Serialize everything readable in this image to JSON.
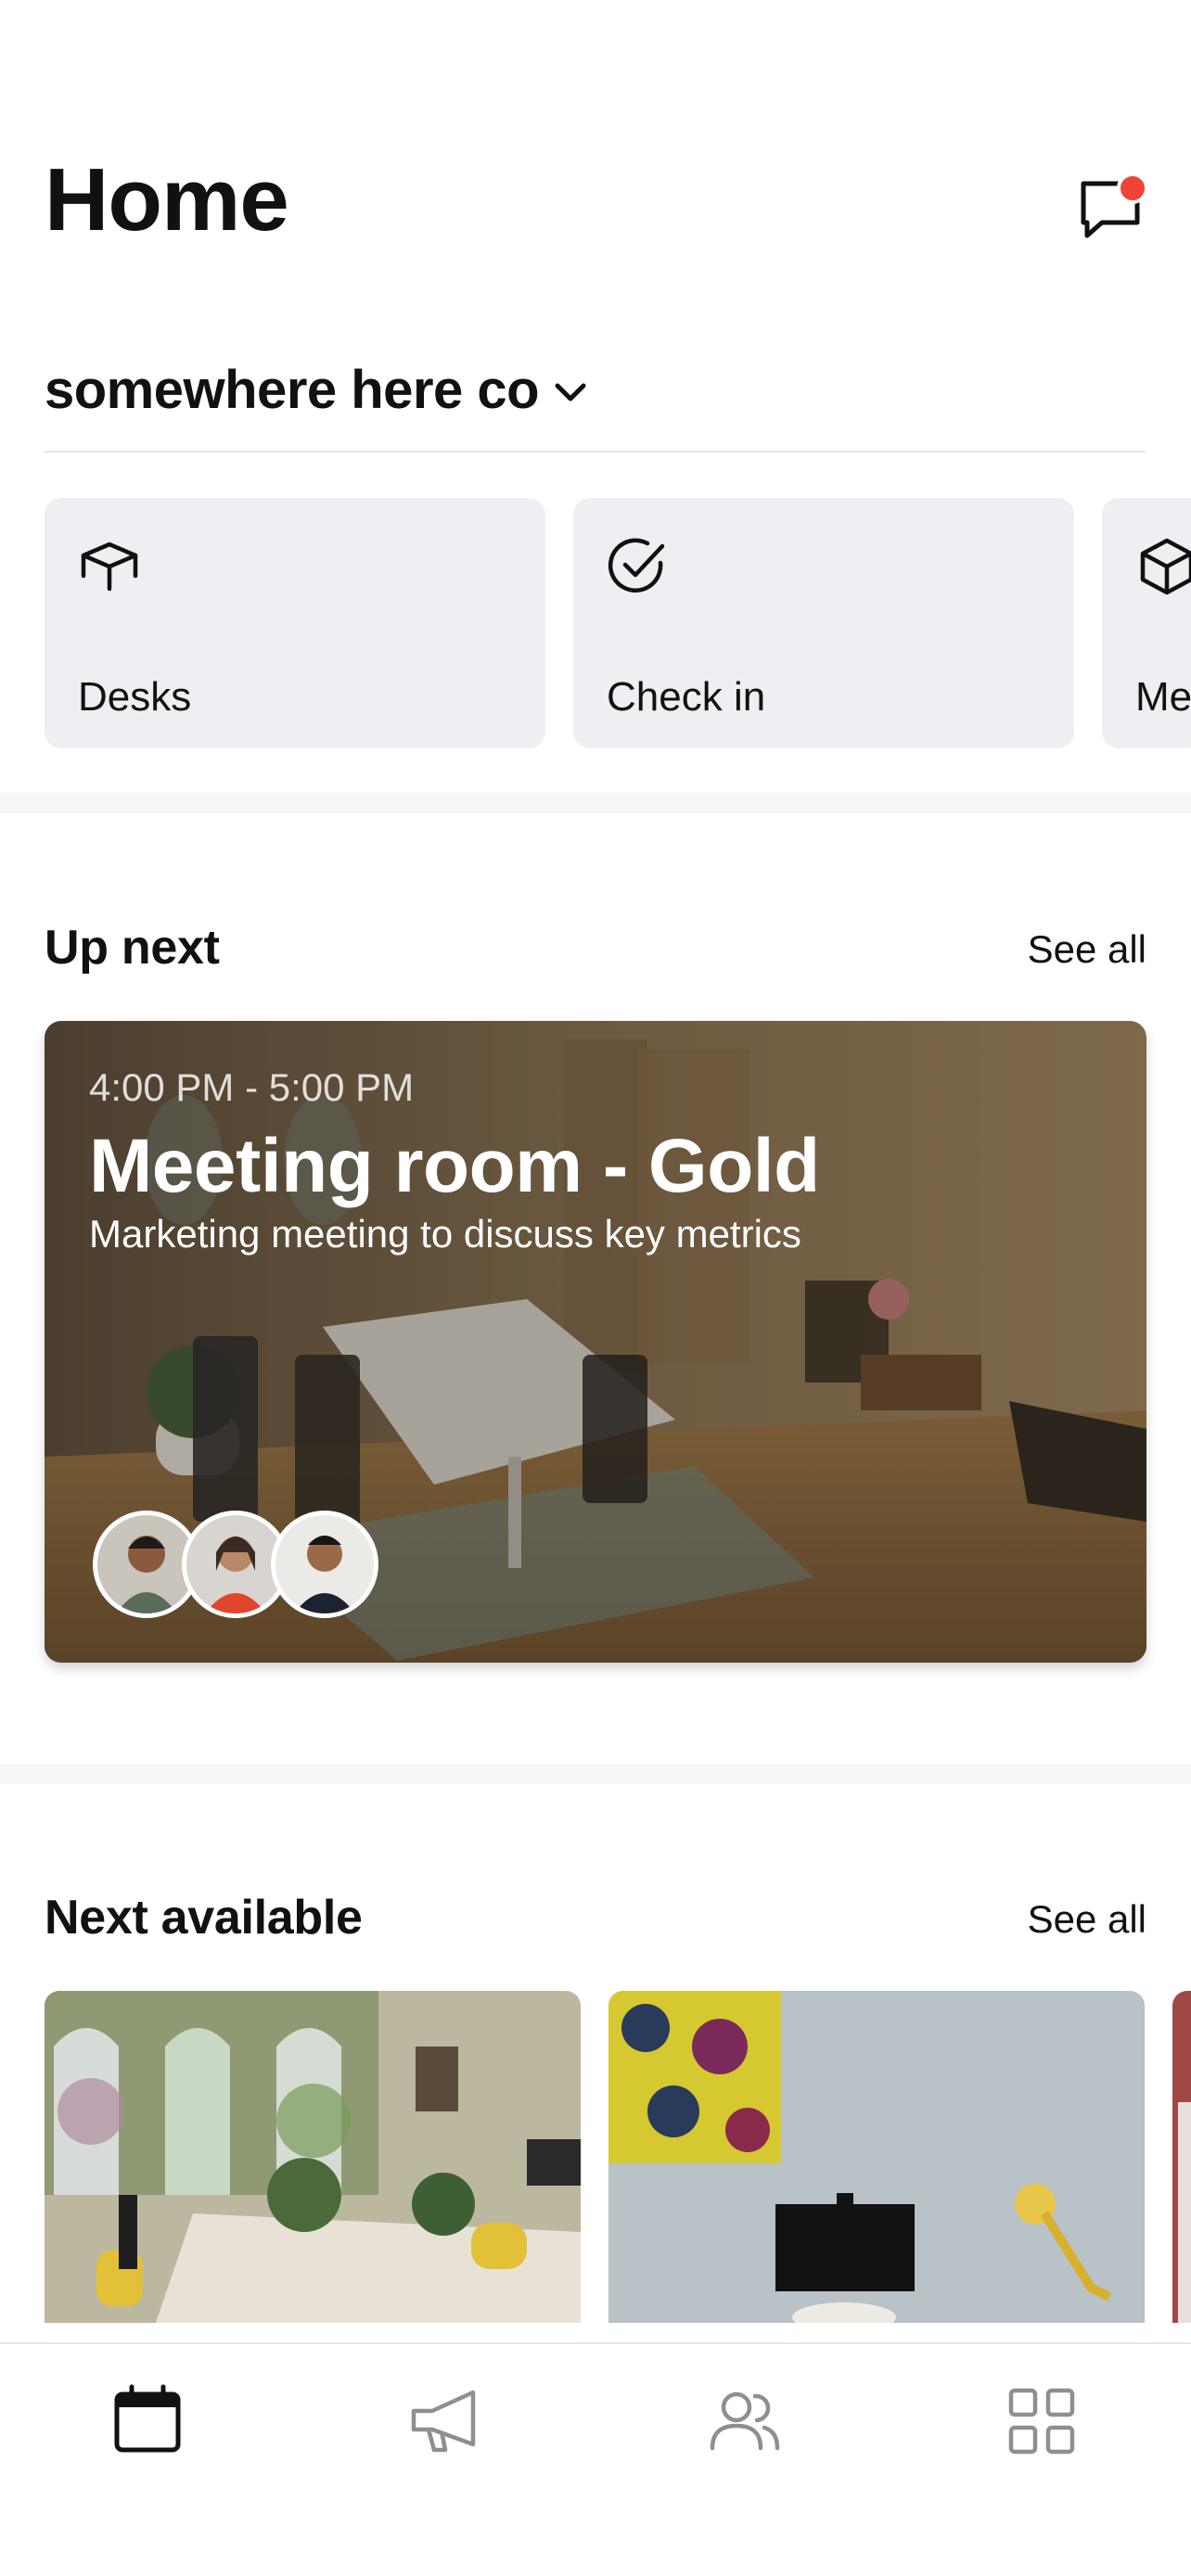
{
  "header": {
    "title": "Home"
  },
  "org": {
    "name": "somewhere here co"
  },
  "quick_actions": [
    {
      "label": "Desks",
      "icon": "desk-box-icon"
    },
    {
      "label": "Check in",
      "icon": "check-circle-icon"
    },
    {
      "label": "Me",
      "icon": "cube-icon"
    }
  ],
  "up_next": {
    "title": "Up next",
    "see_all": "See all",
    "booking": {
      "time": "4:00 PM - 5:00 PM",
      "room": "Meeting room - Gold",
      "description": "Marketing meeting to discuss key metrics"
    }
  },
  "next_available": {
    "title": "Next available",
    "see_all": "See all"
  },
  "tabbar": {
    "tabs": [
      {
        "icon": "calendar-icon",
        "active": true
      },
      {
        "icon": "megaphone-icon",
        "active": false
      },
      {
        "icon": "people-icon",
        "active": false
      },
      {
        "icon": "grid-icon",
        "active": false
      }
    ]
  },
  "colors": {
    "notification_dot": "#f04438",
    "tile_bg": "#efeff3",
    "active_icon": "#111111",
    "inactive_icon": "#8e8e93"
  }
}
